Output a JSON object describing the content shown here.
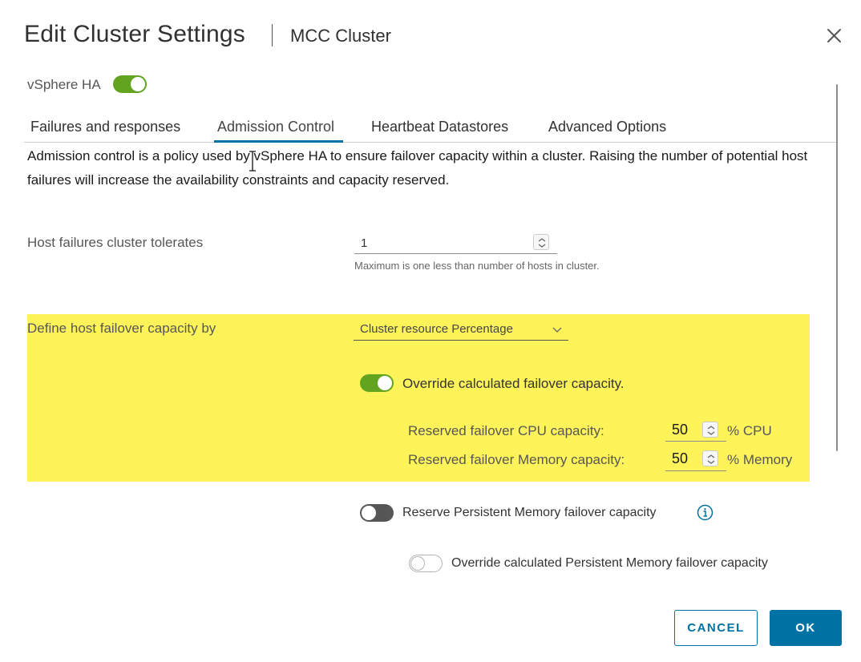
{
  "dialog": {
    "title": "Edit Cluster Settings",
    "subtitle": "MCC Cluster"
  },
  "vsphere_ha": {
    "label": "vSphere HA",
    "enabled": true
  },
  "tabs": [
    {
      "label": "Failures and responses",
      "active": false
    },
    {
      "label": "Admission Control",
      "active": true
    },
    {
      "label": "Heartbeat Datastores",
      "active": false
    },
    {
      "label": "Advanced Options",
      "active": false
    }
  ],
  "admission": {
    "description": "Admission control is a policy used by vSphere HA to ensure failover capacity within a cluster. Raising the number of potential host failures will increase the availability constraints and capacity reserved.",
    "host_failures": {
      "label": "Host failures cluster tolerates",
      "value": "1",
      "help": "Maximum is one less than number of hosts in cluster."
    },
    "define_capacity": {
      "label": "Define host failover capacity by",
      "selected": "Cluster resource Percentage"
    },
    "override": {
      "label": "Override calculated failover capacity.",
      "enabled": true
    },
    "cpu": {
      "label": "Reserved failover CPU capacity:",
      "value": "50",
      "unit": "% CPU"
    },
    "memory": {
      "label": "Reserved failover Memory capacity:",
      "value": "50",
      "unit": "% Memory"
    },
    "pmem": {
      "label": "Reserve Persistent Memory failover capacity",
      "enabled": false
    },
    "pmem_override": {
      "label": "Override calculated Persistent Memory failover capacity",
      "enabled": false
    }
  },
  "colors": {
    "accent": "#0072a3",
    "toggle_on": "#62a420",
    "highlight": "#fef45a"
  },
  "footer": {
    "cancel_label": "CANCEL",
    "ok_label": "OK"
  }
}
